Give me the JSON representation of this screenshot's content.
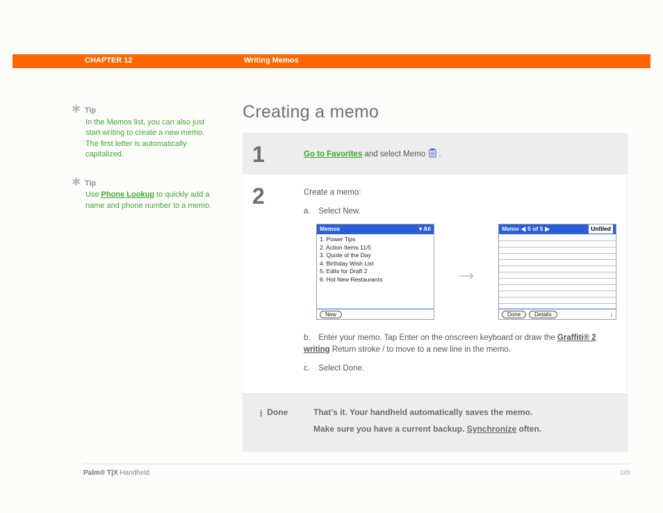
{
  "header": {
    "chapter": "CHAPTER 12",
    "section": "Writing Memos"
  },
  "sidebar": {
    "tip1": {
      "label": "Tip",
      "body": "In the Memos list, you can also just start writing to create a new memo. The first letter is automatically capitalized."
    },
    "tip2": {
      "label": "Tip",
      "pre": "Use ",
      "link": "Phone Lookup",
      "post": " to quickly add a name and phone number to a memo."
    }
  },
  "page": {
    "title": "Creating a memo"
  },
  "step1": {
    "num": "1",
    "link": "Go to Favorites",
    "tail": " and select Memo "
  },
  "step2": {
    "num": "2",
    "intro": "Create a memo:",
    "a_letter": "a.",
    "a_text": "Select New.",
    "b_letter": "b.",
    "b_pre": "Enter your memo. Tap Enter on the onscreen keyboard or draw the ",
    "b_link": "Graffiti® 2 writing",
    "b_post": " Return stroke / to move to a new line in the memo.",
    "c_letter": "c.",
    "c_text": "Select Done."
  },
  "screens": {
    "left": {
      "title": "Memos",
      "dropdown": "▾ All",
      "items": [
        "1. Power Tips",
        "2. Action Items 11/5",
        "3. Quote of the Day",
        "4. Birthday Wish List",
        "5. Edits for Draft 2",
        "6. Hot New Restaurants"
      ],
      "btn_new": "New"
    },
    "right": {
      "title": "Memo",
      "nav": "5 of 5",
      "unfiled": "Unfiled",
      "btn_done": "Done",
      "btn_details": "Details"
    }
  },
  "done": {
    "label": "Done",
    "line1": "That's it. Your handheld automatically saves the memo.",
    "line2_pre": "Make sure you have a current backup. ",
    "line2_link": "Synchronize",
    "line2_post": " often."
  },
  "footer": {
    "brand_bold": "Palm®",
    "brand_mid": " T|X",
    "brand_light": " Handheld",
    "page": "249"
  }
}
